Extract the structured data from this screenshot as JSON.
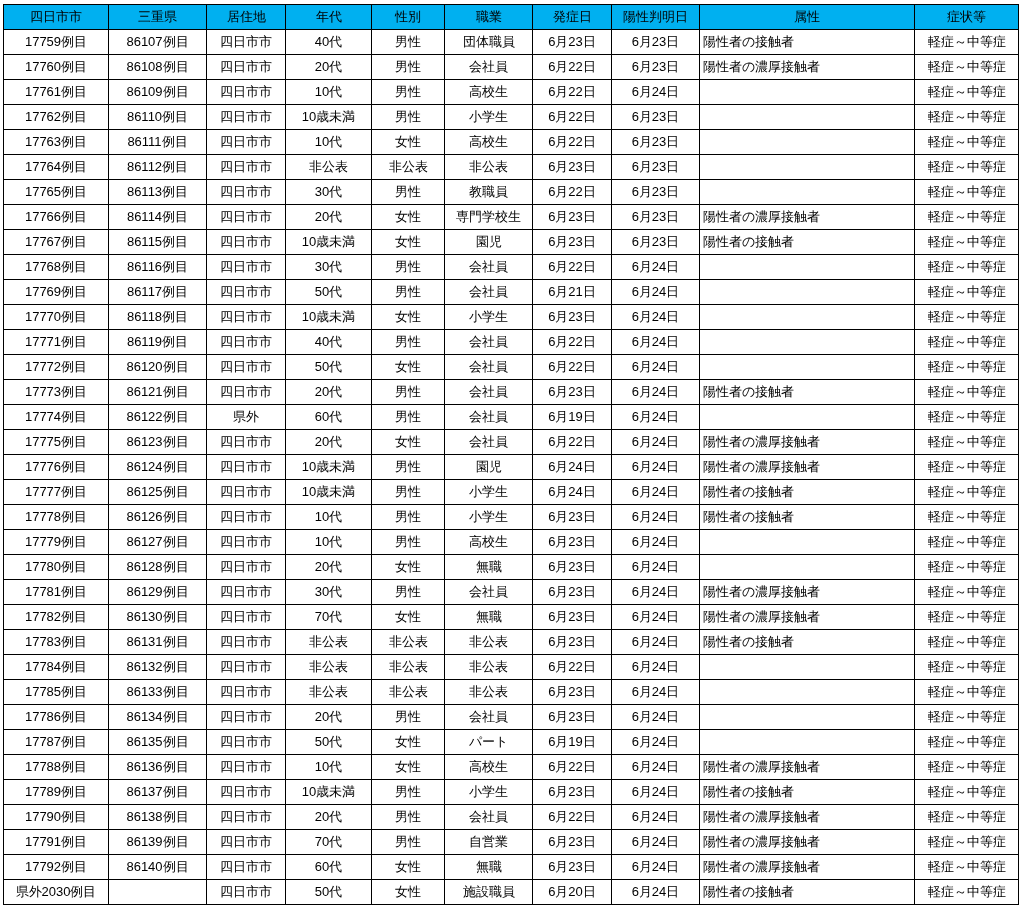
{
  "table": {
    "columns": [
      "四日市市",
      "三重県",
      "居住地",
      "年代",
      "性別",
      "職業",
      "発症日",
      "陽性判明日",
      "属性",
      "症状等"
    ],
    "rows": [
      [
        "17759例目",
        "86107例目",
        "四日市市",
        "40代",
        "男性",
        "団体職員",
        "6月23日",
        "6月23日",
        "陽性者の接触者",
        "軽症～中等症"
      ],
      [
        "17760例目",
        "86108例目",
        "四日市市",
        "20代",
        "男性",
        "会社員",
        "6月22日",
        "6月23日",
        "陽性者の濃厚接触者",
        "軽症～中等症"
      ],
      [
        "17761例目",
        "86109例目",
        "四日市市",
        "10代",
        "男性",
        "高校生",
        "6月22日",
        "6月24日",
        null,
        "軽症～中等症"
      ],
      [
        "17762例目",
        "86110例目",
        "四日市市",
        "10歳未満",
        "男性",
        "小学生",
        "6月22日",
        "6月23日",
        null,
        "軽症～中等症"
      ],
      [
        "17763例目",
        "86111例目",
        "四日市市",
        "10代",
        "女性",
        "高校生",
        "6月22日",
        "6月23日",
        null,
        "軽症～中等症"
      ],
      [
        "17764例目",
        "86112例目",
        "四日市市",
        "非公表",
        "非公表",
        "非公表",
        "6月23日",
        "6月23日",
        null,
        "軽症～中等症"
      ],
      [
        "17765例目",
        "86113例目",
        "四日市市",
        "30代",
        "男性",
        "教職員",
        "6月22日",
        "6月23日",
        null,
        "軽症～中等症"
      ],
      [
        "17766例目",
        "86114例目",
        "四日市市",
        "20代",
        "女性",
        "専門学校生",
        "6月23日",
        "6月23日",
        "陽性者の濃厚接触者",
        "軽症～中等症"
      ],
      [
        "17767例目",
        "86115例目",
        "四日市市",
        "10歳未満",
        "女性",
        "園児",
        "6月23日",
        "6月23日",
        "陽性者の接触者",
        "軽症～中等症"
      ],
      [
        "17768例目",
        "86116例目",
        "四日市市",
        "30代",
        "男性",
        "会社員",
        "6月22日",
        "6月24日",
        null,
        "軽症～中等症"
      ],
      [
        "17769例目",
        "86117例目",
        "四日市市",
        "50代",
        "男性",
        "会社員",
        "6月21日",
        "6月24日",
        null,
        "軽症～中等症"
      ],
      [
        "17770例目",
        "86118例目",
        "四日市市",
        "10歳未満",
        "女性",
        "小学生",
        "6月23日",
        "6月24日",
        null,
        "軽症～中等症"
      ],
      [
        "17771例目",
        "86119例目",
        "四日市市",
        "40代",
        "男性",
        "会社員",
        "6月22日",
        "6月24日",
        null,
        "軽症～中等症"
      ],
      [
        "17772例目",
        "86120例目",
        "四日市市",
        "50代",
        "女性",
        "会社員",
        "6月22日",
        "6月24日",
        null,
        "軽症～中等症"
      ],
      [
        "17773例目",
        "86121例目",
        "四日市市",
        "20代",
        "男性",
        "会社員",
        "6月23日",
        "6月24日",
        "陽性者の接触者",
        "軽症～中等症"
      ],
      [
        "17774例目",
        "86122例目",
        "県外",
        "60代",
        "男性",
        "会社員",
        "6月19日",
        "6月24日",
        null,
        "軽症～中等症"
      ],
      [
        "17775例目",
        "86123例目",
        "四日市市",
        "20代",
        "女性",
        "会社員",
        "6月22日",
        "6月24日",
        "陽性者の濃厚接触者",
        "軽症～中等症"
      ],
      [
        "17776例目",
        "86124例目",
        "四日市市",
        "10歳未満",
        "男性",
        "園児",
        "6月24日",
        "6月24日",
        "陽性者の濃厚接触者",
        "軽症～中等症"
      ],
      [
        "17777例目",
        "86125例目",
        "四日市市",
        "10歳未満",
        "男性",
        "小学生",
        "6月24日",
        "6月24日",
        "陽性者の接触者",
        "軽症～中等症"
      ],
      [
        "17778例目",
        "86126例目",
        "四日市市",
        "10代",
        "男性",
        "小学生",
        "6月23日",
        "6月24日",
        "陽性者の接触者",
        "軽症～中等症"
      ],
      [
        "17779例目",
        "86127例目",
        "四日市市",
        "10代",
        "男性",
        "高校生",
        "6月23日",
        "6月24日",
        null,
        "軽症～中等症"
      ],
      [
        "17780例目",
        "86128例目",
        "四日市市",
        "20代",
        "女性",
        "無職",
        "6月23日",
        "6月24日",
        null,
        "軽症～中等症"
      ],
      [
        "17781例目",
        "86129例目",
        "四日市市",
        "30代",
        "男性",
        "会社員",
        "6月23日",
        "6月24日",
        "陽性者の濃厚接触者",
        "軽症～中等症"
      ],
      [
        "17782例目",
        "86130例目",
        "四日市市",
        "70代",
        "女性",
        "無職",
        "6月23日",
        "6月24日",
        "陽性者の濃厚接触者",
        "軽症～中等症"
      ],
      [
        "17783例目",
        "86131例目",
        "四日市市",
        "非公表",
        "非公表",
        "非公表",
        "6月23日",
        "6月24日",
        "陽性者の接触者",
        "軽症～中等症"
      ],
      [
        "17784例目",
        "86132例目",
        "四日市市",
        "非公表",
        "非公表",
        "非公表",
        "6月22日",
        "6月24日",
        null,
        "軽症～中等症"
      ],
      [
        "17785例目",
        "86133例目",
        "四日市市",
        "非公表",
        "非公表",
        "非公表",
        "6月23日",
        "6月24日",
        null,
        "軽症～中等症"
      ],
      [
        "17786例目",
        "86134例目",
        "四日市市",
        "20代",
        "男性",
        "会社員",
        "6月23日",
        "6月24日",
        null,
        "軽症～中等症"
      ],
      [
        "17787例目",
        "86135例目",
        "四日市市",
        "50代",
        "女性",
        "パート",
        "6月19日",
        "6月24日",
        null,
        "軽症～中等症"
      ],
      [
        "17788例目",
        "86136例目",
        "四日市市",
        "10代",
        "女性",
        "高校生",
        "6月22日",
        "6月24日",
        "陽性者の濃厚接触者",
        "軽症～中等症"
      ],
      [
        "17789例目",
        "86137例目",
        "四日市市",
        "10歳未満",
        "男性",
        "小学生",
        "6月23日",
        "6月24日",
        "陽性者の接触者",
        "軽症～中等症"
      ],
      [
        "17790例目",
        "86138例目",
        "四日市市",
        "20代",
        "男性",
        "会社員",
        "6月22日",
        "6月24日",
        "陽性者の濃厚接触者",
        "軽症～中等症"
      ],
      [
        "17791例目",
        "86139例目",
        "四日市市",
        "70代",
        "男性",
        "自営業",
        "6月23日",
        "6月24日",
        "陽性者の濃厚接触者",
        "軽症～中等症"
      ],
      [
        "17792例目",
        "86140例目",
        "四日市市",
        "60代",
        "女性",
        "無職",
        "6月23日",
        "6月24日",
        "陽性者の濃厚接触者",
        "軽症～中等症"
      ],
      [
        "県外2030例目",
        null,
        "四日市市",
        "50代",
        "女性",
        "施設職員",
        "6月20日",
        "6月24日",
        "陽性者の接触者",
        "軽症～中等症"
      ]
    ]
  }
}
